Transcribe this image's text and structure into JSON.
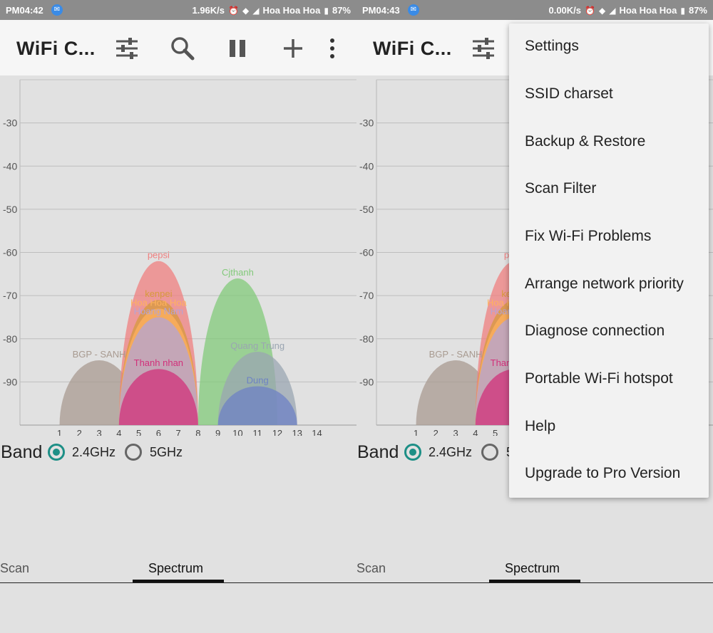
{
  "left": {
    "status": {
      "time": "PM04:42",
      "speed": "1.96K/s",
      "carrier": "Hoa Hoa Hoa",
      "battery": "87%"
    }
  },
  "right": {
    "status": {
      "time": "PM04:43",
      "speed": "0.00K/s",
      "carrier": "Hoa Hoa Hoa",
      "battery": "87%"
    }
  },
  "app": {
    "title": "WiFi C...",
    "toolbar_icons": [
      "filter-sliders-icon",
      "search-icon",
      "pause-icon",
      "add-icon",
      "overflow-menu-icon"
    ]
  },
  "band": {
    "label": "Band",
    "options": [
      {
        "label": "2.4GHz",
        "checked": true
      },
      {
        "label": "5GHz",
        "checked": false
      }
    ]
  },
  "tabs": [
    {
      "label": "Scan",
      "active": false
    },
    {
      "label": "Spectrum",
      "active": true
    }
  ],
  "colors": {
    "accent": "#1d8f86",
    "appbar": "#f6f6f6",
    "statusbar": "#8c8c8c"
  },
  "menu": {
    "items": [
      "Settings",
      "SSID charset",
      "Backup & Restore",
      "Scan Filter",
      "Fix Wi-Fi Problems",
      "Arrange network priority",
      "Diagnose connection",
      "Portable Wi-Fi hotspot",
      "Help",
      "Upgrade to Pro Version"
    ]
  },
  "chart_data": {
    "type": "area",
    "y_ticks": [
      -30,
      -40,
      -50,
      -60,
      -70,
      -80,
      -90
    ],
    "ylim": [
      -100,
      -20
    ],
    "x_ticks": [
      1,
      2,
      3,
      4,
      5,
      6,
      7,
      8,
      9,
      10,
      11,
      12,
      13,
      14
    ],
    "xlim": [
      -1,
      16
    ],
    "grid": true,
    "series": [
      {
        "name": "BGP - SANH",
        "channel": 3,
        "level": -85,
        "color": "#a89a90"
      },
      {
        "name": "pepsi",
        "channel": 6,
        "level": -62,
        "color": "#ef7f7f"
      },
      {
        "name": "kenpei",
        "channel": 6,
        "level": -71,
        "color": "#d79a3c"
      },
      {
        "name": "Hoa Hoa Hoa",
        "channel": 6,
        "level": -73,
        "color": "#ffb25e"
      },
      {
        "name": "Hoang Nam",
        "channel": 6,
        "level": -75,
        "color": "#b3a4d6"
      },
      {
        "name": "Thanh nhan",
        "channel": 6,
        "level": -87,
        "color": "#d2307a"
      },
      {
        "name": "Cjthanh",
        "channel": 10,
        "level": -66,
        "color": "#82c97a"
      },
      {
        "name": "Quang Trung",
        "channel": 11,
        "level": -83,
        "color": "#9aa5b2"
      },
      {
        "name": "Dung",
        "channel": 11,
        "level": -91,
        "color": "#6d82c4"
      }
    ]
  }
}
